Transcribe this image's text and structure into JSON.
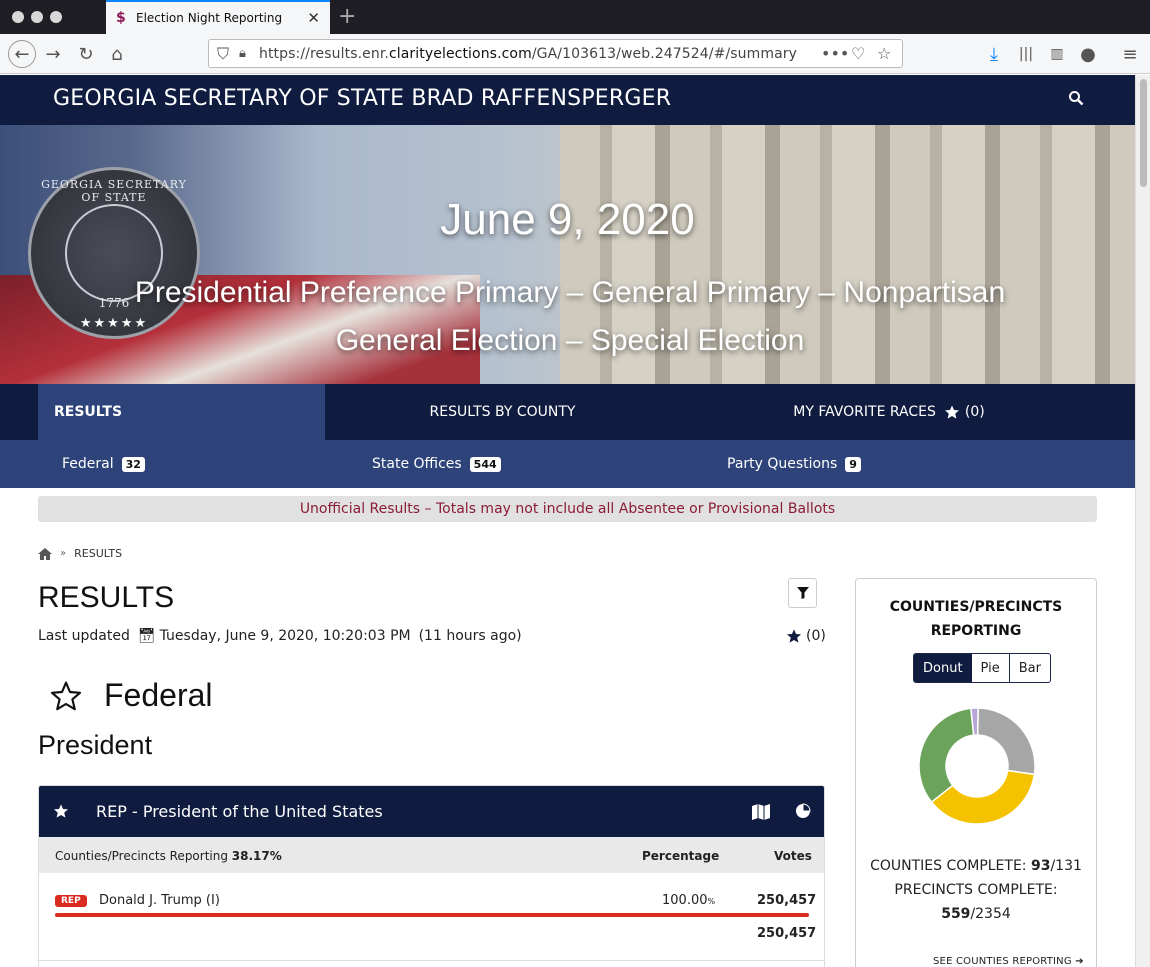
{
  "browser": {
    "tab_title": "Election Night Reporting",
    "url_prefix": "https://results.enr.",
    "url_domain": "clarityelections.com",
    "url_path": "/GA/103613/web.247524/#/summary"
  },
  "site": {
    "title": "GEORGIA SECRETARY OF STATE BRAD RAFFENSPERGER",
    "seal_text": "GEORGIA SECRETARY OF STATE",
    "seal_year": "1776",
    "seal_stars": "★★★★★",
    "date": "June 9, 2020",
    "election_line1": "Presidential Preference Primary – General Primary – Nonpartisan",
    "election_line2": "General Election – Special Election"
  },
  "nav": {
    "results": "RESULTS",
    "by_county": "RESULTS BY COUNTY",
    "favorites": "MY FAVORITE RACES",
    "favorites_count": "(0)"
  },
  "subnav": [
    {
      "label": "Federal",
      "count": "32"
    },
    {
      "label": "State Offices",
      "count": "544"
    },
    {
      "label": "Party Questions",
      "count": "9"
    }
  ],
  "alert": "Unofficial Results – Totals may not include all Absentee or Provisional Ballots",
  "breadcrumb": {
    "current": "RESULTS"
  },
  "main": {
    "heading": "RESULTS",
    "updated_label": "Last updated",
    "updated_value": "Tuesday, June 9, 2020, 10:20:03 PM",
    "updated_ago": "(11 hours ago)",
    "fav_count": "(0)",
    "category": "Federal",
    "office": "President"
  },
  "race": {
    "title": "REP - President of the United States",
    "reporting_label": "Counties/Precincts Reporting",
    "reporting_value": "38.17%",
    "col_percentage": "Percentage",
    "col_votes": "Votes",
    "candidates": [
      {
        "party": "REP",
        "name": "Donald J. Trump (I)",
        "pct": "100.00",
        "pct_sign": "%",
        "votes": "250,457",
        "share": 1.0
      }
    ],
    "total_votes": "250,457"
  },
  "sidebar": {
    "title": "COUNTIES/PRECINCTS REPORTING",
    "toggle": [
      "Donut",
      "Pie",
      "Bar"
    ],
    "counties_label": "COUNTIES COMPLETE:",
    "counties_done": "93",
    "counties_total": "/131",
    "precincts_label": "PRECINCTS COMPLETE:",
    "precincts_done": "559",
    "precincts_total": "/2354",
    "see_link": "SEE COUNTIES REPORTING",
    "donut": [
      {
        "value": 0.27,
        "color": "#a6a6a6"
      },
      {
        "value": 0.37,
        "color": "#f5c200"
      },
      {
        "value": 0.34,
        "color": "#6ca35a"
      },
      {
        "value": 0.02,
        "color": "#b7a6d6"
      }
    ]
  }
}
